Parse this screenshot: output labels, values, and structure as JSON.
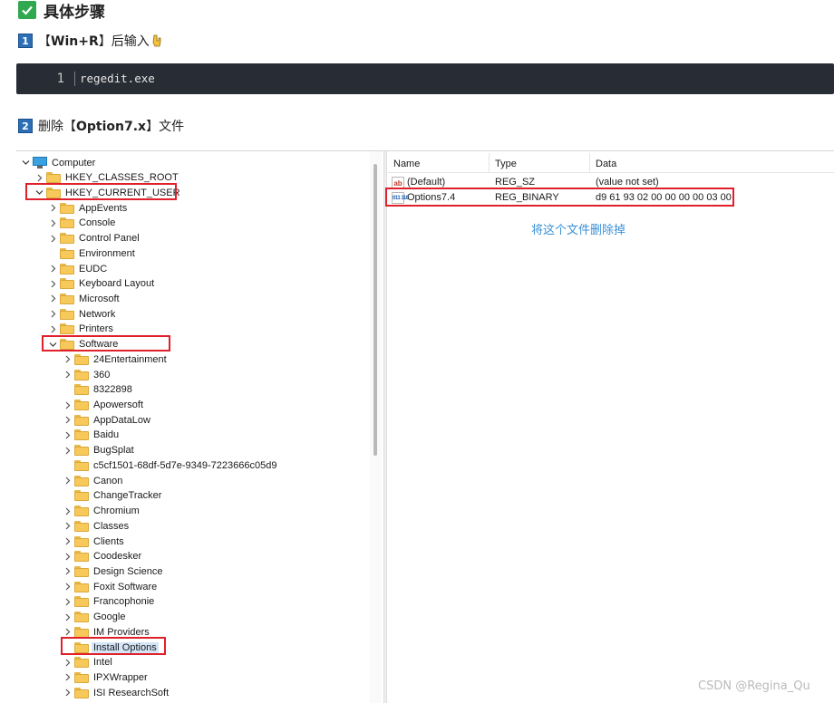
{
  "article": {
    "heading": "具体步骤",
    "step1": {
      "num": "1",
      "pre": "【",
      "key": "Win+R",
      "post": "】后输入",
      "icon": "pointing-down-hand-icon"
    },
    "code": {
      "line_number": "1",
      "text": "regedit.exe"
    },
    "step2": {
      "num": "2",
      "pre": "删除【",
      "key": "Option7.x",
      "post": "】文件"
    }
  },
  "regedit": {
    "tree": [
      {
        "label": "Computer",
        "level": 0,
        "chevron": "down",
        "icon": "computer-icon"
      },
      {
        "label": "HKEY_CLASSES_ROOT",
        "level": 1,
        "chevron": "right",
        "icon": "folder-icon"
      },
      {
        "label": "HKEY_CURRENT_USER",
        "level": 1,
        "chevron": "down",
        "icon": "folder-icon",
        "highlight": true
      },
      {
        "label": "AppEvents",
        "level": 2,
        "chevron": "right",
        "icon": "folder-icon"
      },
      {
        "label": "Console",
        "level": 2,
        "chevron": "right",
        "icon": "folder-icon"
      },
      {
        "label": "Control Panel",
        "level": 2,
        "chevron": "right",
        "icon": "folder-icon"
      },
      {
        "label": "Environment",
        "level": 2,
        "chevron": "none",
        "icon": "folder-icon"
      },
      {
        "label": "EUDC",
        "level": 2,
        "chevron": "right",
        "icon": "folder-icon"
      },
      {
        "label": "Keyboard Layout",
        "level": 2,
        "chevron": "right",
        "icon": "folder-icon"
      },
      {
        "label": "Microsoft",
        "level": 2,
        "chevron": "right",
        "icon": "folder-icon"
      },
      {
        "label": "Network",
        "level": 2,
        "chevron": "right",
        "icon": "folder-icon"
      },
      {
        "label": "Printers",
        "level": 2,
        "chevron": "right",
        "icon": "folder-icon"
      },
      {
        "label": "Software",
        "level": 2,
        "chevron": "down",
        "icon": "folder-icon",
        "highlight": true
      },
      {
        "label": "24Entertainment",
        "level": 3,
        "chevron": "right",
        "icon": "folder-icon"
      },
      {
        "label": "360",
        "level": 3,
        "chevron": "right",
        "icon": "folder-icon"
      },
      {
        "label": "8322898",
        "level": 3,
        "chevron": "none",
        "icon": "folder-icon"
      },
      {
        "label": "Apowersoft",
        "level": 3,
        "chevron": "right",
        "icon": "folder-icon"
      },
      {
        "label": "AppDataLow",
        "level": 3,
        "chevron": "right",
        "icon": "folder-icon"
      },
      {
        "label": "Baidu",
        "level": 3,
        "chevron": "right",
        "icon": "folder-icon"
      },
      {
        "label": "BugSplat",
        "level": 3,
        "chevron": "right",
        "icon": "folder-icon"
      },
      {
        "label": "c5cf1501-68df-5d7e-9349-7223666c05d9",
        "level": 3,
        "chevron": "none",
        "icon": "folder-icon"
      },
      {
        "label": "Canon",
        "level": 3,
        "chevron": "right",
        "icon": "folder-icon"
      },
      {
        "label": "ChangeTracker",
        "level": 3,
        "chevron": "none",
        "icon": "folder-icon"
      },
      {
        "label": "Chromium",
        "level": 3,
        "chevron": "right",
        "icon": "folder-icon"
      },
      {
        "label": "Classes",
        "level": 3,
        "chevron": "right",
        "icon": "folder-icon"
      },
      {
        "label": "Clients",
        "level": 3,
        "chevron": "right",
        "icon": "folder-icon"
      },
      {
        "label": "Coodesker",
        "level": 3,
        "chevron": "right",
        "icon": "folder-icon"
      },
      {
        "label": "Design Science",
        "level": 3,
        "chevron": "right",
        "icon": "folder-icon"
      },
      {
        "label": "Foxit Software",
        "level": 3,
        "chevron": "right",
        "icon": "folder-icon"
      },
      {
        "label": "Francophonie",
        "level": 3,
        "chevron": "right",
        "icon": "folder-icon"
      },
      {
        "label": "Google",
        "level": 3,
        "chevron": "right",
        "icon": "folder-icon"
      },
      {
        "label": "IM Providers",
        "level": 3,
        "chevron": "right",
        "icon": "folder-icon"
      },
      {
        "label": "Install Options",
        "level": 3,
        "chevron": "none",
        "icon": "folder-icon",
        "highlight": true,
        "selected": true
      },
      {
        "label": "Intel",
        "level": 3,
        "chevron": "right",
        "icon": "folder-icon"
      },
      {
        "label": "IPXWrapper",
        "level": 3,
        "chevron": "right",
        "icon": "folder-icon"
      },
      {
        "label": "ISI ResearchSoft",
        "level": 3,
        "chevron": "right",
        "icon": "folder-icon"
      }
    ],
    "columns": [
      "Name",
      "Type",
      "Data"
    ],
    "values": [
      {
        "name": "(Default)",
        "type": "REG_SZ",
        "data": "(value not set)",
        "icon": "string-value-icon",
        "icon_text": "ab"
      },
      {
        "name": "Options7.4",
        "type": "REG_BINARY",
        "data": "d9 61 93 02 00 00 00 00 03 00",
        "icon": "binary-value-icon",
        "icon_text": "011 110",
        "highlight": true
      }
    ],
    "annotation": "将这个文件删除掉"
  },
  "watermark": "CSDN @Regina_Qu",
  "colors": {
    "highlight": "#e0202a",
    "step_badge": "#2c6fb7",
    "check": "#2fa84f",
    "annotation": "#3a8fd6",
    "code_bg": "#282c34"
  }
}
